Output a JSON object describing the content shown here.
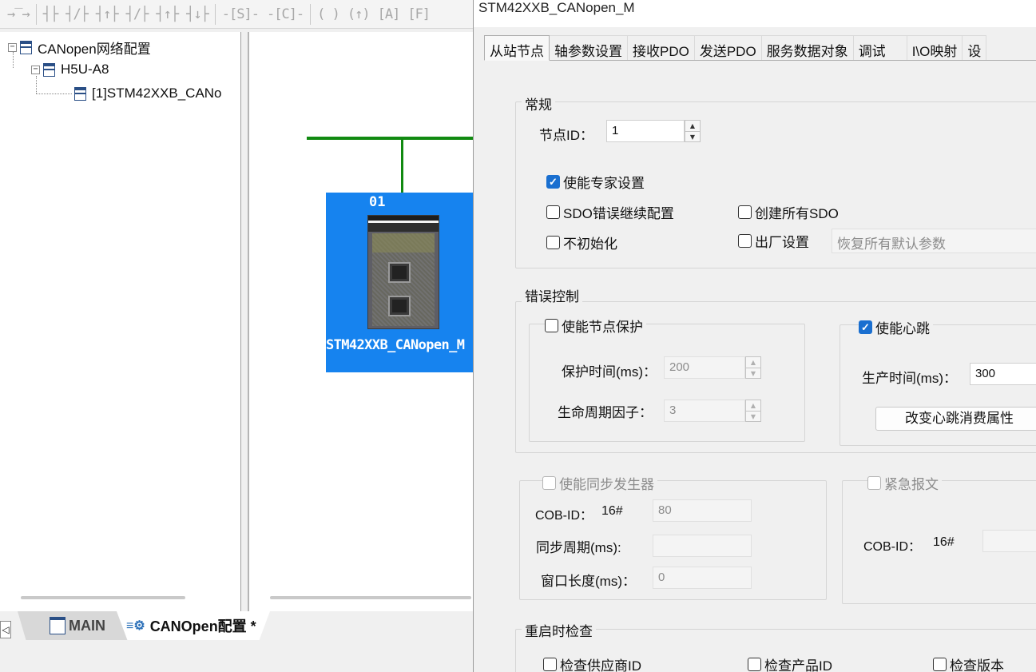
{
  "toolbar": {
    "buttons": [
      "→‾→",
      "┤├",
      "┤/├",
      "┤↑├",
      "┤/├",
      "┤↑├",
      "┤↓├",
      "-[S]-",
      "-[C]-",
      "( )",
      "(↑)",
      "[A]",
      "[F]"
    ]
  },
  "tree": {
    "root": "CANopen网络配置",
    "master": "H5U-A8",
    "slave": "[1]STM42XXB_CANo"
  },
  "device": {
    "node_number": "01",
    "label": "STM42XXB_CANopen_M"
  },
  "bottom_tabs": {
    "scroll_left": "◁",
    "main": "MAIN",
    "canopen": "CANOpen配置 *"
  },
  "dialog": {
    "title": "STM42XXB_CANopen_M",
    "tabs": [
      "从站节点",
      "轴参数设置",
      "接收PDO",
      "发送PDO",
      "服务数据对象",
      "调试",
      "I\\O映射",
      "设"
    ],
    "general": {
      "title": "常规",
      "node_id_label": "节点ID：",
      "node_id_value": "1",
      "expert_settings": "使能专家设置",
      "sdo_error_continue": "SDO错误继续配置",
      "create_all_sdo": "创建所有SDO",
      "no_init": "不初始化",
      "factory_settings": "出厂设置",
      "restore_defaults": "恢复所有默认参数"
    },
    "error_control": {
      "title": "错误控制",
      "node_guarding": "使能节点保护",
      "guard_time_label": "保护时间(ms)：",
      "guard_time_value": "200",
      "life_factor_label": "生命周期因子：",
      "life_factor_value": "3",
      "heartbeat": "使能心跳",
      "producer_time_label": "生产时间(ms)：",
      "producer_time_value": "300",
      "heartbeat_consumer_button": "改变心跳消费属性"
    },
    "sync": {
      "title": "使能同步发生器",
      "cob_id_label": "COB-ID：",
      "hex_prefix": "16#",
      "cob_id_value": "80",
      "period_label": "同步周期(ms):",
      "window_label": "窗口长度(ms)：",
      "window_value": "0"
    },
    "emergency": {
      "title": "紧急报文",
      "cob_id_label": "COB-ID：",
      "hex_prefix": "16#"
    },
    "restart_check": {
      "title": "重启时检查",
      "vendor_id": "检查供应商ID",
      "product_id": "检查产品ID",
      "revision": "检查版本"
    }
  },
  "colors": {
    "bus_line": "#118a11",
    "device_block": "#1683ef",
    "checkbox_checked": "#1a6fd0"
  }
}
